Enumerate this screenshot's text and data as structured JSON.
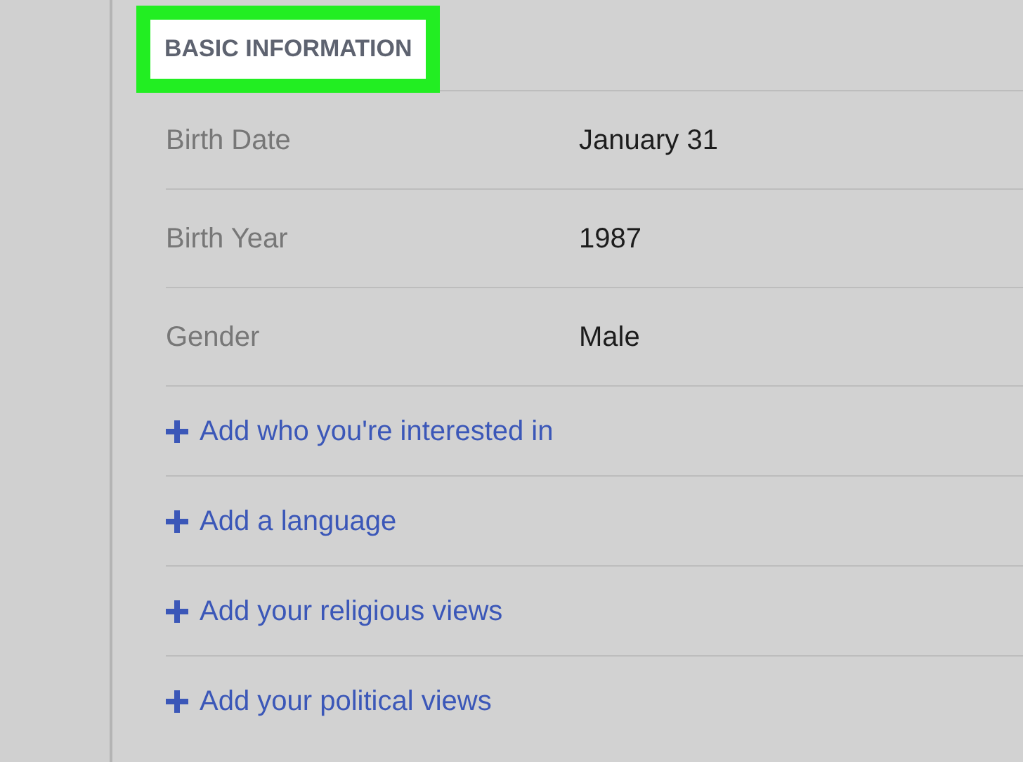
{
  "section": {
    "heading": "BASIC INFORMATION",
    "highlighted": true
  },
  "fields": [
    {
      "label": "Birth Date",
      "value": "January 31"
    },
    {
      "label": "Birth Year",
      "value": "1987"
    },
    {
      "label": "Gender",
      "value": "Male"
    }
  ],
  "links": [
    "Add who you're interested in",
    "Add a language",
    "Add your religious views",
    "Add your political views"
  ]
}
